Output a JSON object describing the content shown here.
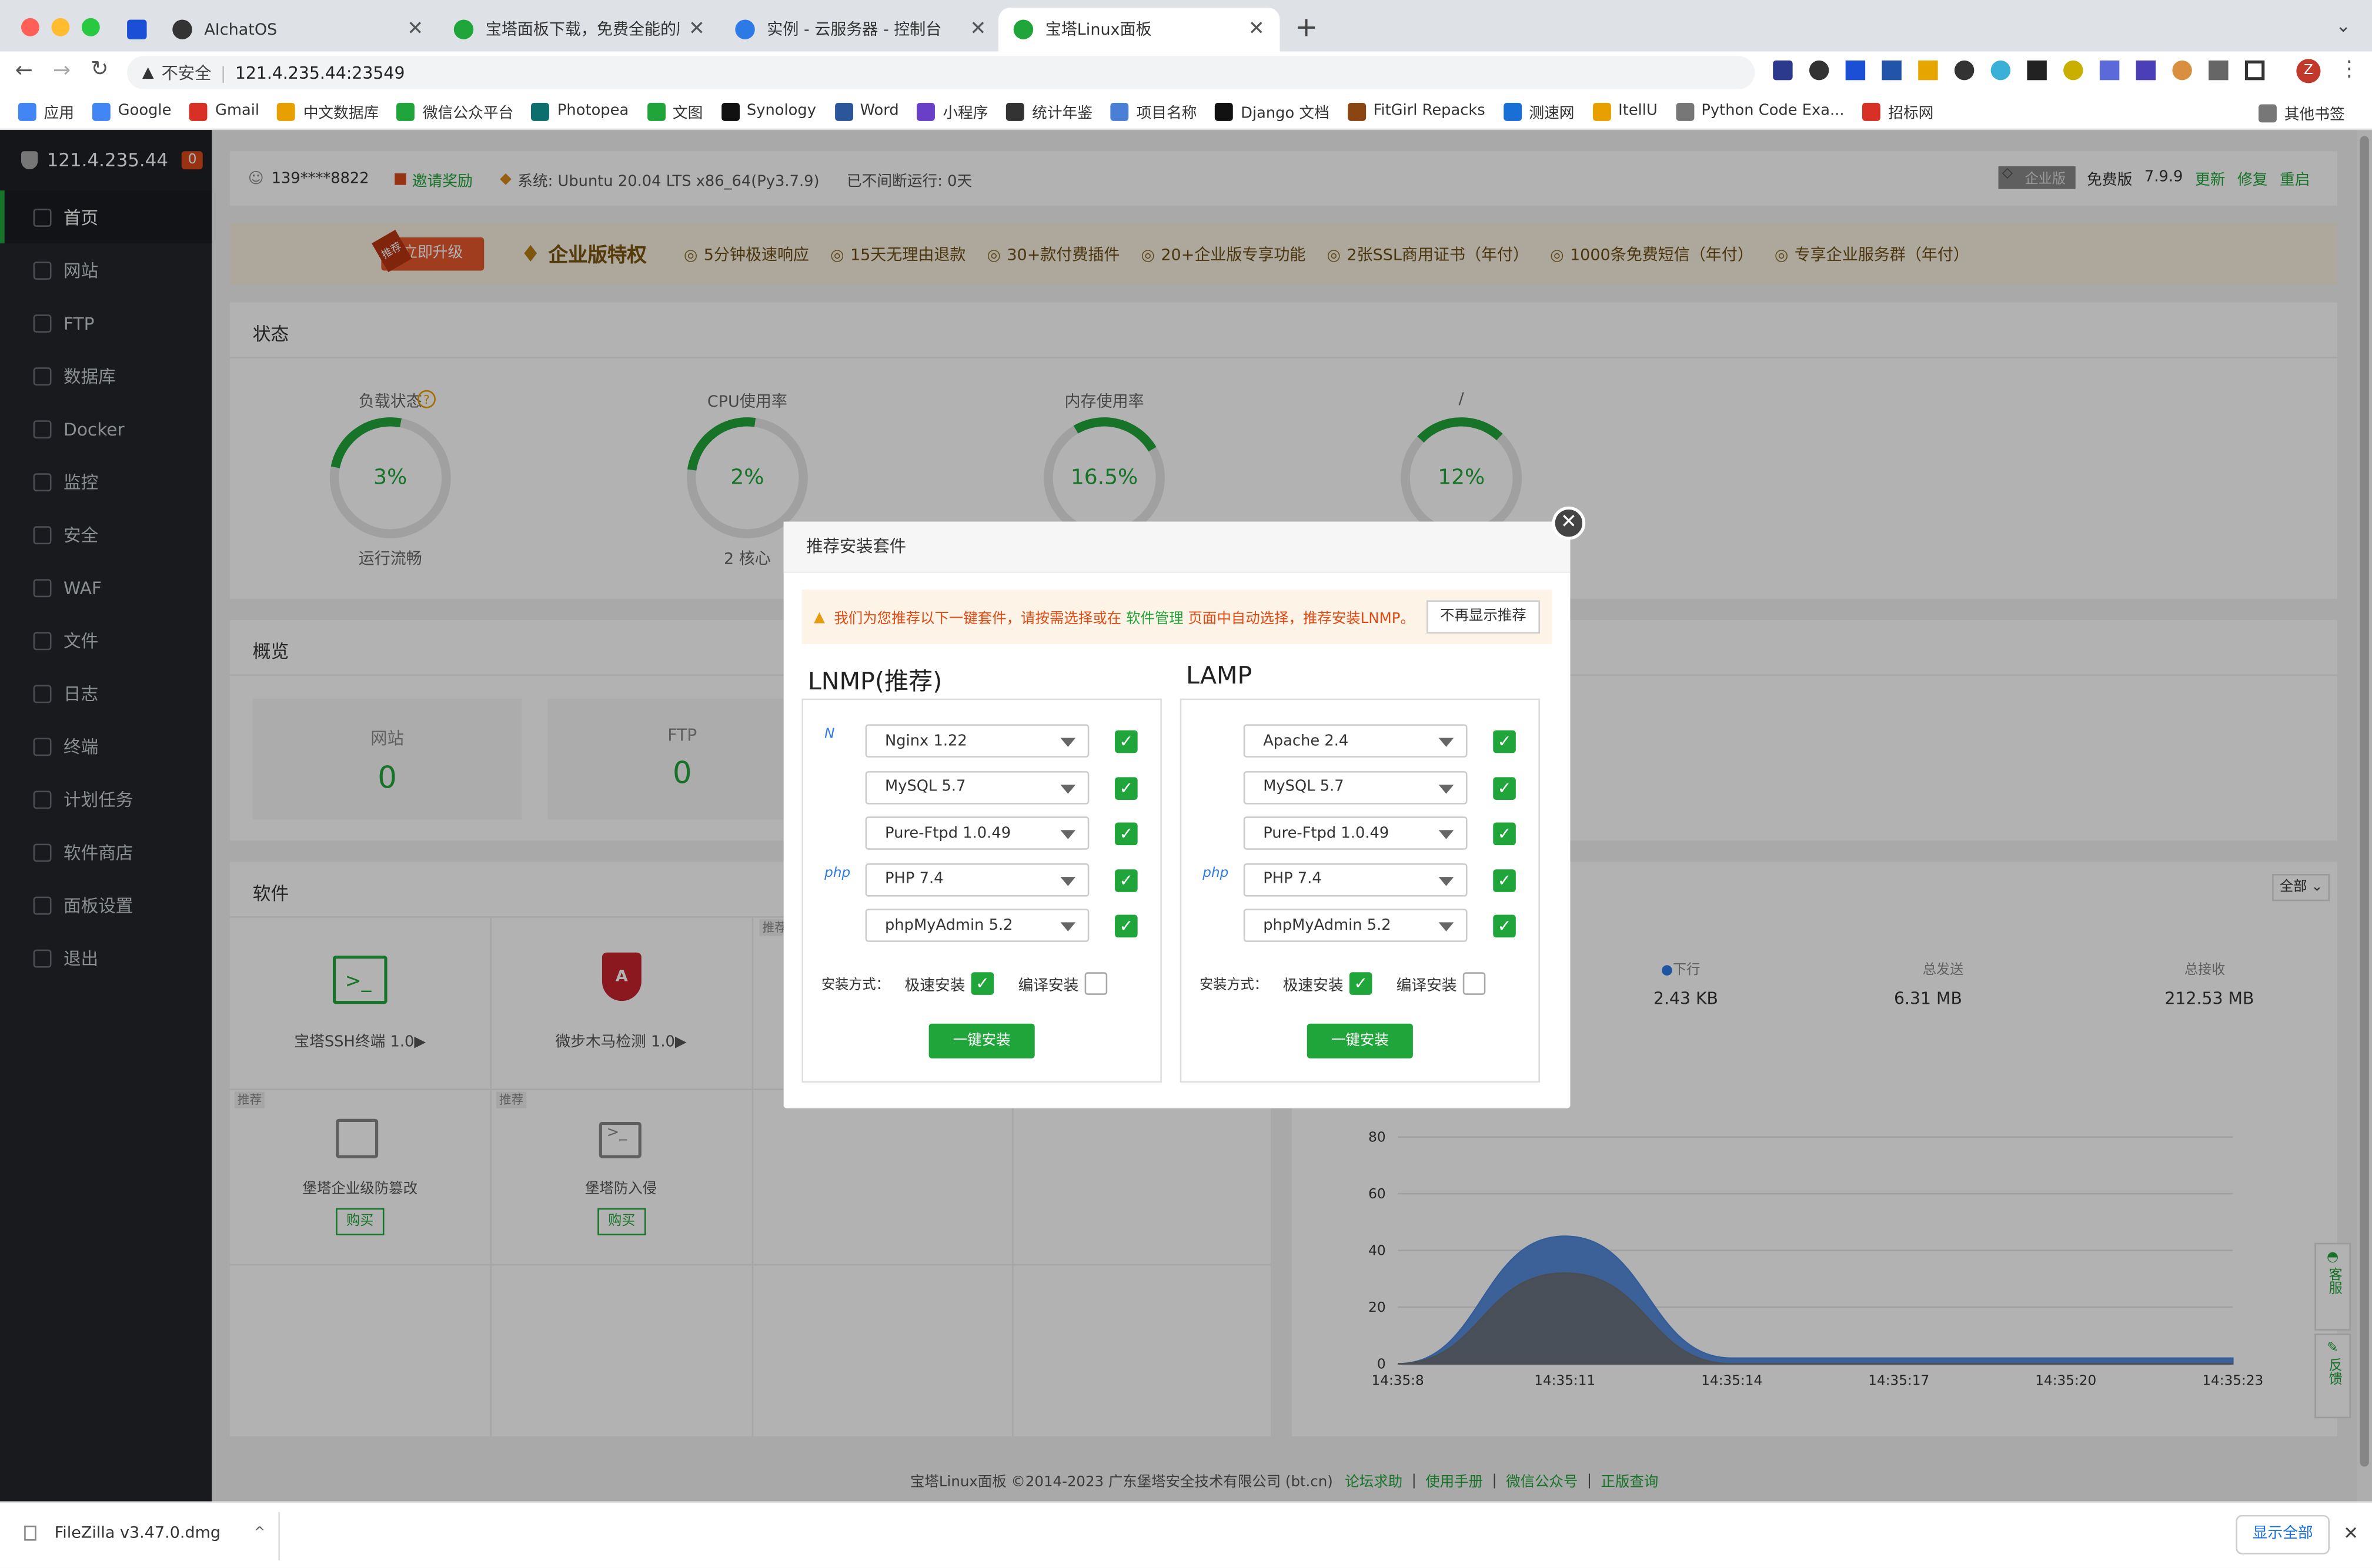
{
  "browser": {
    "tabs": [
      {
        "title": ""
      },
      {
        "title": "AIchatOS"
      },
      {
        "title": "宝塔面板下载，免费全能的服务器"
      },
      {
        "title": "实例 - 云服务器 - 控制台"
      },
      {
        "title": "宝塔Linux面板"
      }
    ],
    "insecure_label": "不安全",
    "url": "121.4.235.44:23549",
    "bookmarks": [
      "应用",
      "Google",
      "Gmail",
      "中文数据库",
      "微信公众平台",
      "Photopea",
      "文图",
      "Synology",
      "Word",
      "小程序",
      "统计年鉴",
      "项目名称",
      "Django 文档",
      "FitGirl Repacks",
      "测速网",
      "ItellU",
      "Python Code Exa...",
      "招标网"
    ],
    "other_bookmarks": "其他书签",
    "profile_initial": "Z"
  },
  "sidebar": {
    "server_ip": "121.4.235.44",
    "badge": "0",
    "items": [
      {
        "label": "首页"
      },
      {
        "label": "网站"
      },
      {
        "label": "FTP"
      },
      {
        "label": "数据库"
      },
      {
        "label": "Docker"
      },
      {
        "label": "监控"
      },
      {
        "label": "安全"
      },
      {
        "label": "WAF"
      },
      {
        "label": "文件"
      },
      {
        "label": "日志"
      },
      {
        "label": "终端"
      },
      {
        "label": "计划任务"
      },
      {
        "label": "软件商店"
      },
      {
        "label": "面板设置"
      },
      {
        "label": "退出"
      }
    ]
  },
  "topbar": {
    "user": "139****8822",
    "invite": "邀请奖励",
    "system": "系统:  Ubuntu 20.04 LTS x86_64(Py3.7.9)",
    "uptime": "已不间断运行: 0天",
    "edition_badge": "企业版",
    "free_label": "免费版",
    "version": "7.9.9",
    "update": "更新",
    "repair": "修复",
    "restart": "重启"
  },
  "promo": {
    "tag": "推荐",
    "upgrade": "立即升级",
    "title": "企业版特权",
    "features": [
      "5分钟极速响应",
      "15天无理由退款",
      "30+款付费插件",
      "20+企业版专享功能",
      "2张SSL商用证书（年付）",
      "1000条免费短信（年付）",
      "专享企业服务群（年付）"
    ]
  },
  "status": {
    "title": "状态",
    "gauges": [
      {
        "label": "负载状态",
        "value": "3%",
        "sub": "运行流畅",
        "pct": 3
      },
      {
        "label": "CPU使用率",
        "value": "2%",
        "sub": "2 核心",
        "pct": 2
      },
      {
        "label": "内存使用率",
        "value": "16.5%",
        "sub": "",
        "pct": 16.5
      },
      {
        "label": "/",
        "value": "12%",
        "sub": "",
        "pct": 12
      }
    ]
  },
  "overview": {
    "title": "概览",
    "items": [
      {
        "label": "网站",
        "value": "0"
      },
      {
        "label": "FTP",
        "value": "0"
      }
    ]
  },
  "software": {
    "title": "软件",
    "filter": "全部",
    "recommend_tag": "推荐",
    "items": [
      {
        "name": "宝塔SSH终端 1.0▶"
      },
      {
        "name": "微步木马检测 1.0▶"
      },
      {
        "name": "堡塔企业级防篡改",
        "buy": "购买"
      },
      {
        "name": "堡塔防入侵",
        "buy": "购买"
      }
    ]
  },
  "traffic": {
    "down_label": "下行",
    "down_value": "2.43 KB",
    "sent_label": "总发送",
    "sent_value": "6.31 MB",
    "recv_label": "总接收",
    "recv_value": "212.53 MB"
  },
  "chart_data": {
    "type": "area",
    "x": [
      "14:35:8",
      "14:35:11",
      "14:35:14",
      "14:35:17",
      "14:35:20",
      "14:35:23"
    ],
    "yticks": [
      0,
      20,
      40,
      60,
      80
    ],
    "ylim": [
      0,
      80
    ],
    "series": [
      {
        "values": [
          0,
          45,
          2,
          2,
          2,
          2
        ],
        "color": "#4d86d9"
      },
      {
        "values": [
          0,
          32,
          0,
          0,
          0,
          0
        ],
        "color": "#6b7075"
      }
    ]
  },
  "float_buttons": {
    "service": "客服",
    "feedback": "反馈"
  },
  "footer": {
    "copyright": "宝塔Linux面板 ©2014-2023 广东堡塔安全技术有限公司 (bt.cn)",
    "links": [
      "论坛求助",
      "使用手册",
      "微信公众号",
      "正版查询"
    ]
  },
  "modal": {
    "title": "推荐安装套件",
    "notice_pre": "我们为您推荐以下一键套件，请按需选择或在",
    "notice_link": "软件管理",
    "notice_post": "页面中自动选择，推荐安装LNMP。",
    "dismiss": "不再显示推荐",
    "mode_label": "安装方式：",
    "fast": "极速安装",
    "compile": "编译安装",
    "install": "一键安装",
    "stacks": [
      {
        "title": "LNMP(推荐)",
        "items": [
          {
            "value": "Nginx 1.22",
            "icon": "nginx-icon"
          },
          {
            "value": "MySQL 5.7",
            "icon": "mysql-icon"
          },
          {
            "value": "Pure-Ftpd 1.0.49",
            "icon": "ftp-icon"
          },
          {
            "value": "PHP 7.4",
            "icon": "php-icon"
          },
          {
            "value": "phpMyAdmin 5.2",
            "icon": "phpmyadmin-icon"
          }
        ]
      },
      {
        "title": "LAMP",
        "items": [
          {
            "value": "Apache 2.4",
            "icon": "apache-icon"
          },
          {
            "value": "MySQL 5.7",
            "icon": "mysql-icon"
          },
          {
            "value": "Pure-Ftpd 1.0.49",
            "icon": "ftp-icon"
          },
          {
            "value": "PHP 7.4",
            "icon": "php-icon"
          },
          {
            "value": "phpMyAdmin 5.2",
            "icon": "phpmyadmin-icon"
          }
        ]
      }
    ]
  },
  "download": {
    "file": "FileZilla v3.47.0.dmg",
    "show_all": "显示全部"
  }
}
